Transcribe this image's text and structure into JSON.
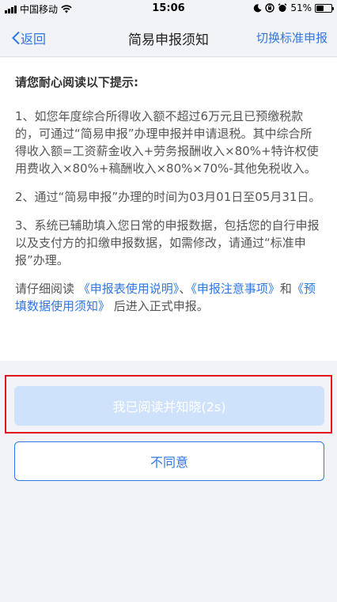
{
  "status_bar": {
    "carrier": "中国移动",
    "time": "15:06",
    "battery": "51%",
    "battery_level": 0.51
  },
  "nav": {
    "back_label": "返回",
    "title": "简易申报须知",
    "right_label": "切换标准申报"
  },
  "content": {
    "heading": "请您耐心阅读以下提示:",
    "para1": "1、如您年度综合所得收入额不超过6万元且已预缴税款的，可通过“简易申报”办理申报并申请退税。其中综合所得收入额=工资薪金收入+劳务报酬收入×80%+特许权使用费收入×80%+稿酬收入×80%×70%-其他免税收入。",
    "para2": "2、通过“简易申报”办理的时间为03月01日至05月31日。",
    "para3": "3、系统已辅助填入您日常的申报数据，包括您的自行申报以及支付方的扣缴申报数据，如需修改，请通过“标准申报”办理。",
    "read_prefix": "请仔细阅读",
    "link1": "《申报表使用说明》",
    "sep": "、",
    "link2": "《申报注意事项》",
    "and": "和",
    "link3": "《预填数据使用须知》",
    "read_suffix": "后进入正式申报。"
  },
  "buttons": {
    "agree": "我已阅读并知晓(2s)",
    "disagree": "不同意"
  },
  "colors": {
    "accent": "#2e77e5",
    "disabled_button": "#cfe2fb",
    "highlight": "#e4141b"
  }
}
